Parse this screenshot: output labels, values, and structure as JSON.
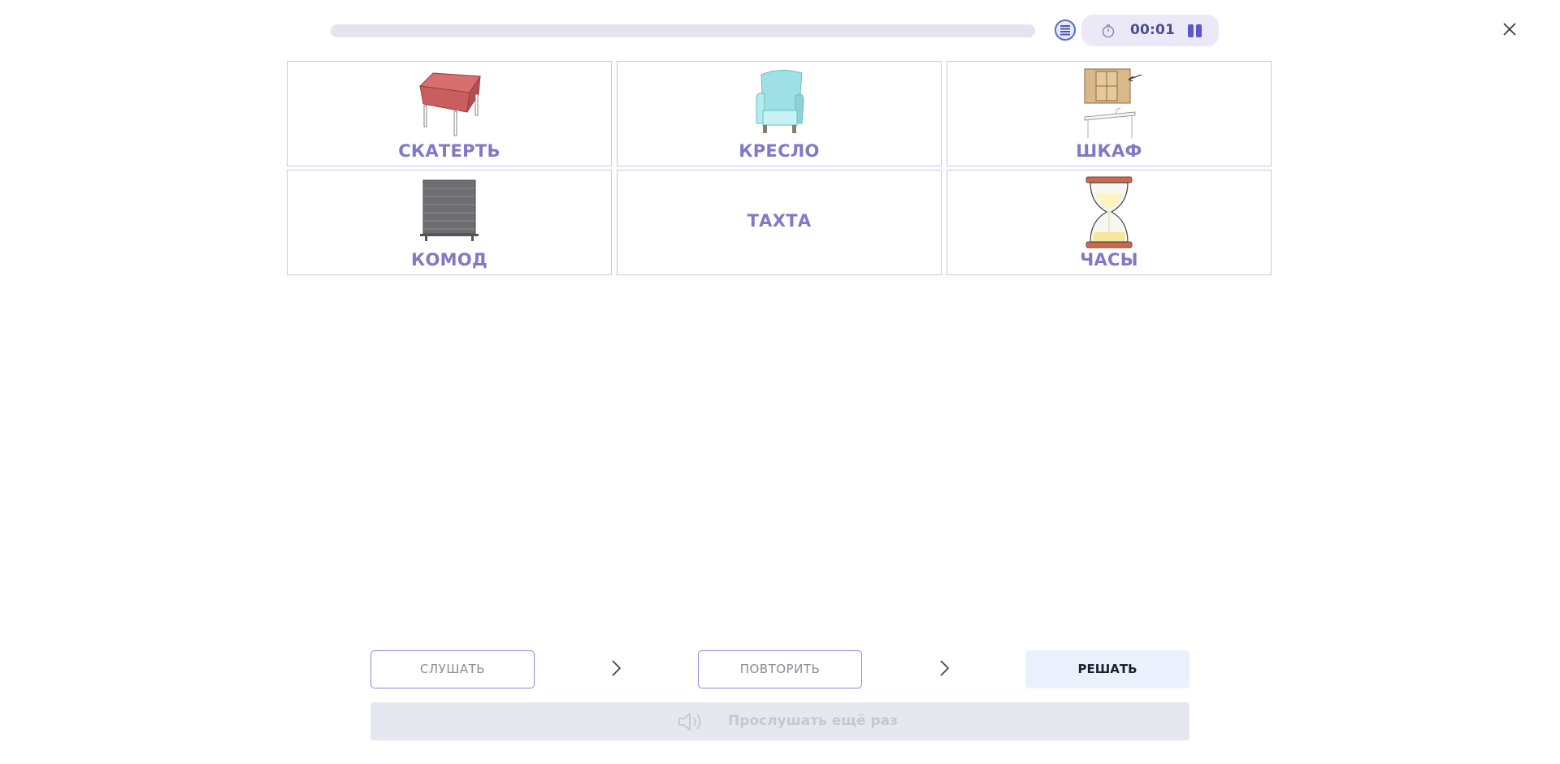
{
  "header": {
    "progress_fraction": 0.0,
    "timer": "00:01",
    "icons": [
      "list-icon",
      "stopwatch-icon",
      "pause-icon",
      "close-icon"
    ]
  },
  "cards": [
    {
      "label": "СКАТЕРТЬ",
      "image": "tablecloth-illustration"
    },
    {
      "label": "КРЕСЛО",
      "image": "armchair-illustration"
    },
    {
      "label": "ШКАФ",
      "image": "wall-cabinet-illustration"
    },
    {
      "label": "КОМОД",
      "image": "dresser-illustration"
    },
    {
      "label": "ТАХТА",
      "image": ""
    },
    {
      "label": "ЧАСЫ",
      "image": "hourglass-illustration"
    }
  ],
  "controls": {
    "listen_label": "СЛУШАТЬ",
    "repeat_label": "ПОВТОРИТЬ",
    "solve_label": "РЕШАТЬ",
    "listen_again_label": "Прослушать ещё раз"
  },
  "colors": {
    "accent": "#5a55d4",
    "label": "#7f7ac4",
    "card_border": "#c9c6e6",
    "solve_bg": "#eaf1fd",
    "disabled_bg": "#e5e8ee"
  }
}
